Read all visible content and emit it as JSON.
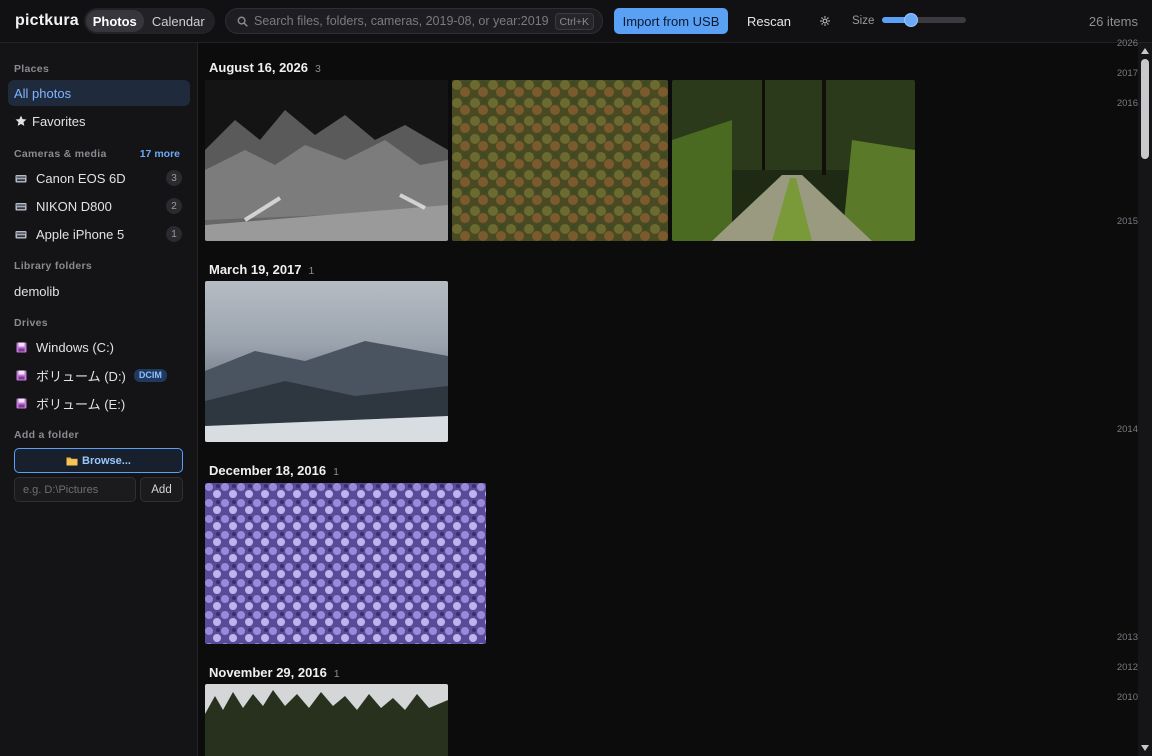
{
  "app": {
    "name": "pictkura"
  },
  "topbar": {
    "views": [
      {
        "label": "Photos",
        "active": true
      },
      {
        "label": "Calendar",
        "active": false
      }
    ],
    "search": {
      "placeholder": "Search files, folders, cameras, 2019-08, or year:2019",
      "value": "",
      "shortcut": "Ctrl+K",
      "icon": "search-icon"
    },
    "import_label": "Import from USB",
    "rescan_label": "Rescan",
    "settings_icon": "gear-icon",
    "size_label": "Size",
    "size_value": 0.35,
    "items_count": "26 items",
    "accent_color": "#5aa0f5"
  },
  "sidebar": {
    "places_title": "Places",
    "places": [
      {
        "label": "All photos",
        "active": true
      },
      {
        "label": "Favorites",
        "icon": "star-icon"
      }
    ],
    "cameras_title": "Cameras & media",
    "cameras_more": "17 more",
    "cameras": [
      {
        "label": "Canon EOS 6D",
        "count": "3",
        "icon": "camera-icon"
      },
      {
        "label": "NIKON D800",
        "count": "2",
        "icon": "camera-icon"
      },
      {
        "label": "Apple iPhone 5",
        "count": "1",
        "icon": "camera-icon"
      }
    ],
    "library_title": "Library folders",
    "library": [
      {
        "label": "demolib"
      }
    ],
    "drives_title": "Drives",
    "drives": [
      {
        "label": "Windows (C:)",
        "icon": "drive-icon"
      },
      {
        "label": "ボリューム (D:)",
        "icon": "drive-icon",
        "tag": "DCIM"
      },
      {
        "label": "ボリューム (E:)",
        "icon": "drive-icon"
      }
    ],
    "add_folder_title": "Add a folder",
    "browse_label": "Browse...",
    "folder_input_placeholder": "e.g. D:\\Pictures",
    "add_label": "Add"
  },
  "groups": [
    {
      "date": "August 16, 2026",
      "count": "3"
    },
    {
      "date": "March 19, 2017",
      "count": "1"
    },
    {
      "date": "December 18, 2016",
      "count": "1"
    },
    {
      "date": "November 29, 2016",
      "count": "1"
    }
  ],
  "timeline": {
    "years": [
      "2026",
      "2017",
      "2016",
      "2015",
      "2014",
      "2013",
      "2012",
      "2010"
    ]
  }
}
